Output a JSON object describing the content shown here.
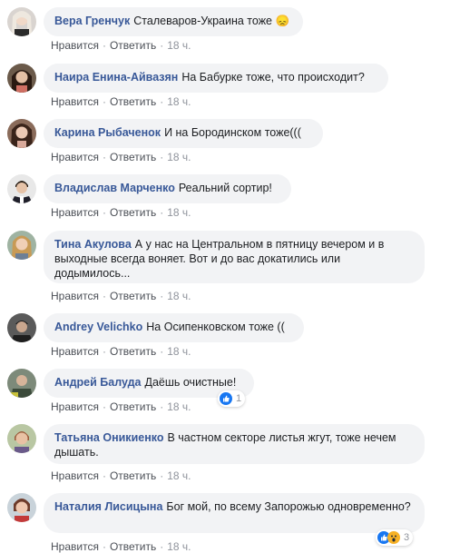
{
  "actions": {
    "like": "Нравится",
    "reply": "Ответить",
    "separator": "·"
  },
  "comments": [
    {
      "author": "Вера Гренчук",
      "text": "Сталеваров-Украина тоже",
      "emoji": "😞",
      "time": "18 ч."
    },
    {
      "author": "Наира Енина-Айвазян",
      "text": "На Бабурке тоже, что происходит?",
      "time": "18 ч."
    },
    {
      "author": "Карина Рыбаченок",
      "text": "И на Бородинском тоже(((",
      "time": "18 ч."
    },
    {
      "author": "Владислав Марченко",
      "text": "Реальний сортир!",
      "time": "18 ч."
    },
    {
      "author": "Тина Акулова",
      "text": "А у нас на Центральном в пятницу вечером и в выходные всегда воняет. Вот и до вас докатились или додымилось...",
      "time": "18 ч."
    },
    {
      "author": "Andrey Velichko",
      "text": "На Осипенковском тоже ((",
      "time": "18 ч."
    },
    {
      "author": "Андрей Балуда",
      "text": "Даёшь очистные!",
      "time": "18 ч.",
      "reactions": {
        "count": "1",
        "icons": [
          "like-icon"
        ]
      }
    },
    {
      "author": "Татьяна Оникиенко",
      "text": "В частном секторе листья жгут, тоже нечем дышать.",
      "time": "18 ч."
    },
    {
      "author": "Наталия Лисицына",
      "text": "Бог мой, по всему Запорожью одновременно?",
      "time": "18 ч.",
      "reactions": {
        "count": "3",
        "icons": [
          "like-icon",
          "wow-icon"
        ]
      }
    }
  ]
}
